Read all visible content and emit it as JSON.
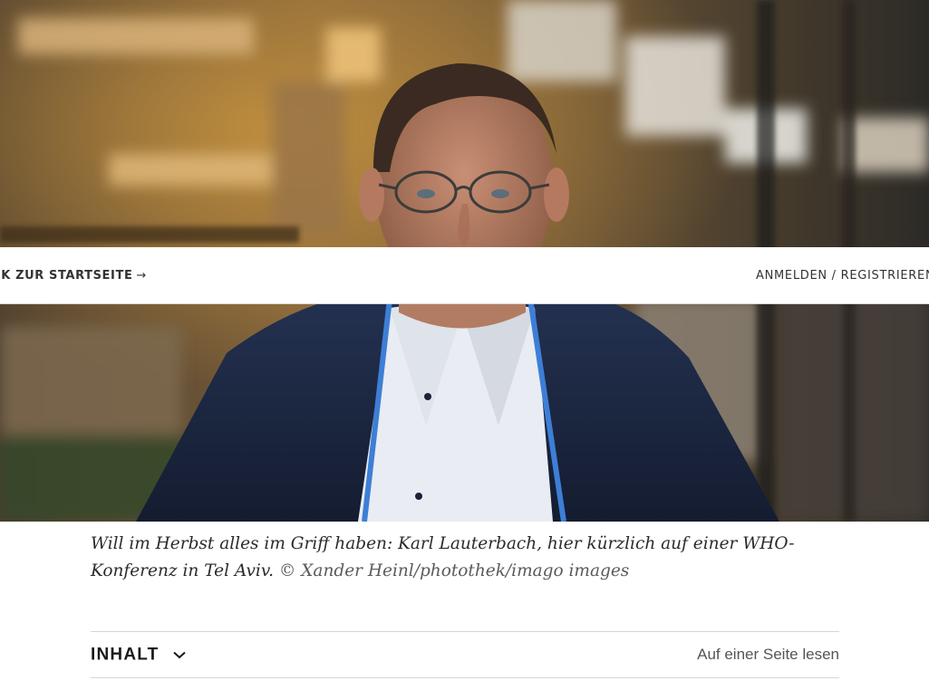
{
  "nav": {
    "back_label": "ÜCK ZUR STARTSEITE",
    "back_arrow": "→",
    "login_label": "ANMELDEN / REGISTRIEREN"
  },
  "hero": {
    "caption_text": "Will im Herbst alles im Griff haben: Karl Lauterbach, hier kürzlich auf einer WHO-Konferenz in Tel Aviv.",
    "credit": "© Xander Heinl/photothek/imago images"
  },
  "toc": {
    "title": "INHALT",
    "chevron_icon": "chevron-down-icon",
    "single_page_label": "Auf einer Seite lesen"
  },
  "colors": {
    "text_dark": "#1a1a1a",
    "text_muted": "#555555",
    "divider": "#d6d6d6"
  }
}
